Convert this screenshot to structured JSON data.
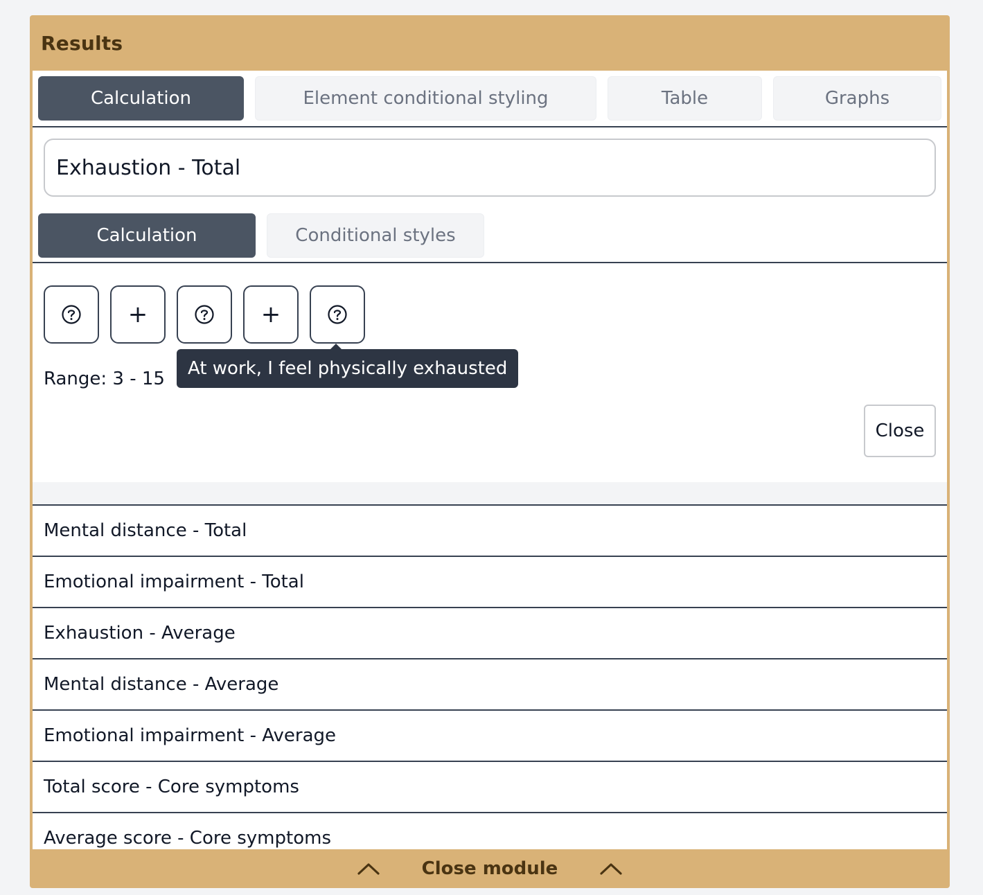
{
  "module": {
    "title": "Results",
    "footer_label": "Close module"
  },
  "top_tabs": [
    {
      "label": "Calculation",
      "active": true
    },
    {
      "label": "Element conditional styling",
      "active": false
    },
    {
      "label": "Table",
      "active": false
    },
    {
      "label": "Graphs",
      "active": false
    }
  ],
  "element": {
    "name_value": "Exhaustion - Total"
  },
  "sub_tabs": [
    {
      "label": "Calculation",
      "active": true
    },
    {
      "label": "Conditional styles",
      "active": false
    }
  ],
  "calculation": {
    "tokens": [
      "question-icon",
      "plus-icon",
      "question-icon",
      "plus-icon",
      "question-icon"
    ],
    "tooltip": "At work, I feel physically exhausted",
    "range_text": "Range: 3 - 15",
    "close_label": "Close"
  },
  "results_list": [
    "Mental distance - Total",
    "Emotional impairment - Total",
    "Exhaustion - Average",
    "Mental distance - Average",
    "Emotional impairment - Average",
    "Total score - Core symptoms",
    "Average score - Core symptoms"
  ],
  "colors": {
    "module_bg": "#d9b277",
    "active_tab": "#4b5563",
    "tooltip_bg": "#2d3543"
  }
}
